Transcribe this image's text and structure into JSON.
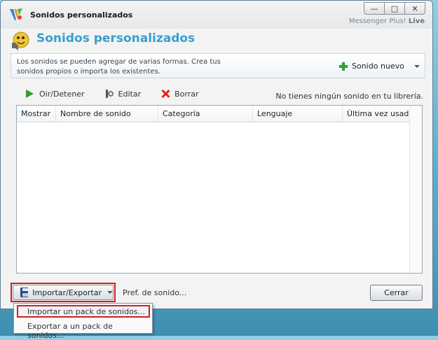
{
  "window": {
    "title": "Sonidos personalizados",
    "brand_name": "Messenger Plus!",
    "brand_suffix": "Live",
    "controls": {
      "minimize": "—",
      "maximize": "□",
      "close": "✕"
    }
  },
  "header": {
    "title": "Sonidos personalizados"
  },
  "info": {
    "text": "Los sonidos se pueden agregar de varias formas. Crea tus sonidos propios o importa los existentes.",
    "new_sound_label": "Sonido nuevo"
  },
  "toolbar": {
    "play_label": "Oir/Detener",
    "edit_label": "Editar",
    "delete_label": "Borrar",
    "status": "No tienes ningún sonido en tu librería."
  },
  "table": {
    "columns": [
      "Mostrar",
      "Nombre de sonido",
      "Categoría",
      "Lenguaje",
      "Última vez usado"
    ],
    "rows": []
  },
  "footer": {
    "import_export_label": "Importar/Exportar",
    "pref_label": "Pref. de sonido...",
    "close_label": "Cerrar"
  },
  "menu": {
    "items": [
      "Importar un pack de sonidos...",
      "Exportar a un pack de sonidos..."
    ]
  },
  "colors": {
    "title_blue": "#3a9ecf",
    "highlight_red": "#d22020",
    "plus_green": "#3cae3c"
  },
  "icons": {
    "app": "messenger-plus-logo-icon",
    "header": "speaker-smiley-icon",
    "new_sound": "plus-icon",
    "play": "play-icon",
    "edit": "edit-icon",
    "delete": "delete-x-icon",
    "import_export": "floppy-disk-icon"
  }
}
